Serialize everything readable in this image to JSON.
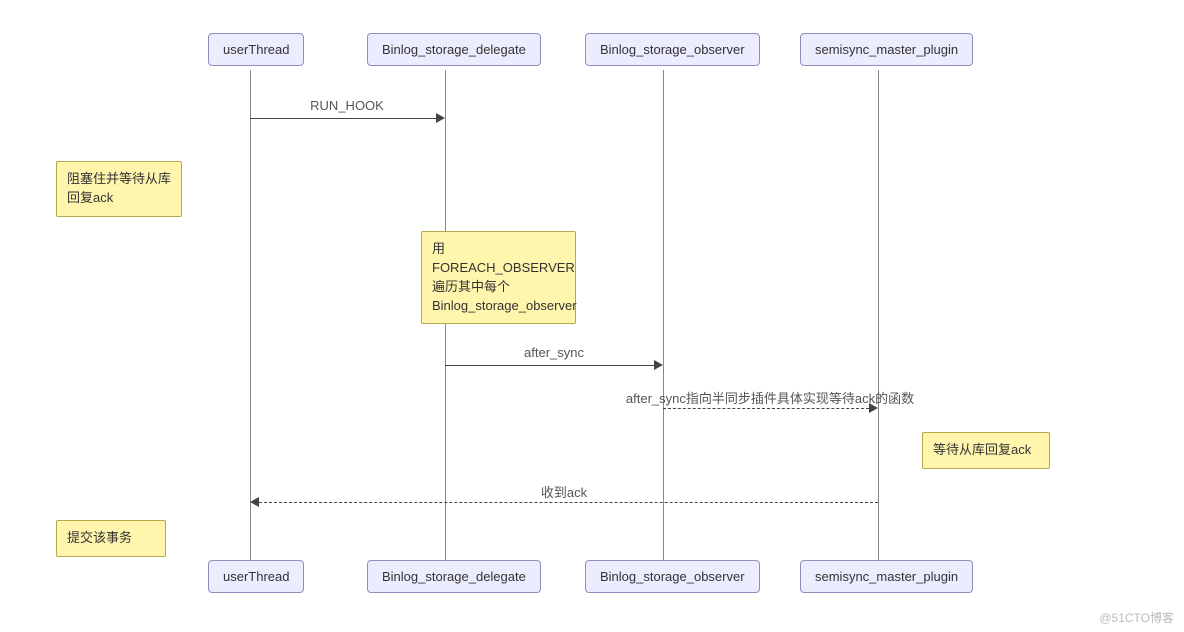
{
  "participants": {
    "p1": "userThread",
    "p2": "Binlog_storage_delegate",
    "p3": "Binlog_storage_observer",
    "p4": "semisync_master_plugin"
  },
  "notes": {
    "n1": "阻塞住并等待从库回复ack",
    "n2": "用FOREACH_OBSERVER遍历其中每个Binlog_storage_observer",
    "n3": "等待从库回复ack",
    "n4": "提交该事务"
  },
  "messages": {
    "m1": "RUN_HOOK",
    "m2": "after_sync",
    "m3": "after_sync指向半同步插件具体实现等待ack的函数",
    "m4": "收到ack"
  },
  "watermark": "@51CTO博客"
}
